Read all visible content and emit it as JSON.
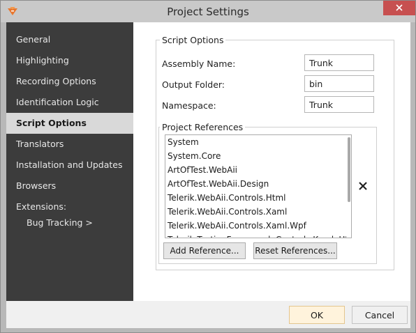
{
  "window": {
    "title": "Project Settings",
    "app_icon": "telerik-logo-icon",
    "close_icon": "close-icon"
  },
  "sidebar": {
    "items": [
      {
        "label": "General",
        "selected": false
      },
      {
        "label": "Highlighting",
        "selected": false
      },
      {
        "label": "Recording Options",
        "selected": false
      },
      {
        "label": "Identification Logic",
        "selected": false
      },
      {
        "label": "Script Options",
        "selected": true
      },
      {
        "label": "Translators",
        "selected": false
      },
      {
        "label": "Installation and Updates",
        "selected": false
      },
      {
        "label": "Browsers",
        "selected": false
      }
    ],
    "extensions_label": "Extensions:",
    "extensions": [
      {
        "label": "Bug Tracking >"
      }
    ]
  },
  "script_options": {
    "group_title": "Script Options",
    "assembly_name_label": "Assembly Name:",
    "assembly_name_value": "Trunk",
    "output_folder_label": "Output Folder:",
    "output_folder_value": "bin",
    "namespace_label": "Namespace:",
    "namespace_value": "Trunk"
  },
  "project_references": {
    "group_title": "Project References",
    "items": [
      "System",
      "System.Core",
      "ArtOfTest.WebAii",
      "ArtOfTest.WebAii.Design",
      "Telerik.WebAii.Controls.Html",
      "Telerik.WebAii.Controls.Xaml",
      "Telerik.WebAii.Controls.Xaml.Wpf",
      "Telerik.TestingFramework.Controls.KendoUI"
    ],
    "remove_icon": "close-x-icon",
    "add_button": "Add Reference...",
    "reset_button": "Reset References..."
  },
  "footer": {
    "ok_button": "OK",
    "cancel_button": "Cancel"
  },
  "colors": {
    "sidebar_bg": "#3c3c3c",
    "selected_item_bg": "#d9d9d9",
    "ok_button_bg": "#fff3dc",
    "close_button_bg": "#c75050"
  }
}
